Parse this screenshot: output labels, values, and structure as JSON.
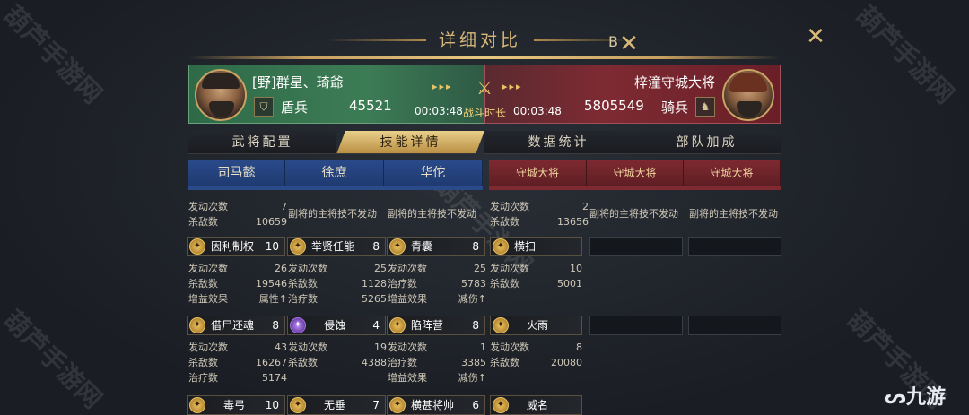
{
  "window": {
    "title": "详细对比",
    "title_fragment": "B"
  },
  "left": {
    "name": "[野]群星、琦爺",
    "troop": "盾兵",
    "power": "45521",
    "time": "00:03:48"
  },
  "right": {
    "name": "梓潼守城大将",
    "troop": "骑兵",
    "power": "5805549",
    "time": "00:03:48"
  },
  "center": {
    "battle_label": "战斗时长"
  },
  "tabs": [
    "武将配置",
    "技能详情",
    "数据统计",
    "部队加成"
  ],
  "active_tab": 1,
  "generals_left": [
    "司马懿",
    "徐庶",
    "华佗"
  ],
  "generals_right": [
    "守城大将",
    "守城大将",
    "守城大将"
  ],
  "labels": {
    "trigger": "发动次数",
    "kills": "杀敌数",
    "heal": "治疗数",
    "buff": "增益效果",
    "no_trigger": "副将的主将技不发动"
  },
  "top_stats": [
    {
      "trigger": "7",
      "kills": "10659"
    },
    {
      "no_trigger": true
    },
    {
      "no_trigger": true
    },
    {
      "trigger": "2",
      "kills": "13656"
    },
    {
      "no_trigger": true
    },
    {
      "no_trigger": true
    }
  ],
  "skill_row1": [
    {
      "icon": "gold-skill-icon",
      "name": "因利制权",
      "level": "10",
      "trigger": "26",
      "kills": "19546",
      "buff": "属性↑"
    },
    {
      "icon": "gold-skill-icon",
      "name": "举贤任能",
      "level": "8",
      "trigger": "25",
      "kills": "1128",
      "heal": "5265"
    },
    {
      "icon": "gold-skill-icon",
      "name": "青囊",
      "level": "8",
      "trigger": "25",
      "heal": "5783",
      "buff": "减伤↑"
    },
    {
      "icon": "gold-skill-icon",
      "name": "横扫",
      "trigger": "10",
      "kills": "5001"
    }
  ],
  "skill_row2": [
    {
      "icon": "gold-skill-icon",
      "name": "借尸还魂",
      "level": "8",
      "trigger": "43",
      "kills": "16267",
      "heal": "5174"
    },
    {
      "icon": "purple-skill-icon",
      "name": "侵蚀",
      "level": "4",
      "trigger": "19",
      "kills": "4388"
    },
    {
      "icon": "gold-skill-icon",
      "name": "陷阵营",
      "level": "8",
      "trigger": "1",
      "heal": "3385",
      "buff": "减伤↑"
    },
    {
      "icon": "gold-skill-icon",
      "name": "火雨",
      "trigger": "8",
      "kills": "20080"
    }
  ],
  "skill_row3": [
    {
      "name": "毒弓",
      "level": "10"
    },
    {
      "name": "无垂",
      "level": "7"
    },
    {
      "name": "横甚将帅",
      "level": "6"
    },
    {
      "name": "威名"
    }
  ],
  "watermarks": [
    "葫芦手游网",
    "葫芦手游网",
    "葫芦手游网",
    "葫芦手游网",
    "葫芦手游网",
    "葫芦手游网"
  ],
  "corner_logo": "九游",
  "colors": {
    "gold": "#d8b878",
    "left_team": "#3c7c55",
    "right_team": "#7e2a32"
  }
}
